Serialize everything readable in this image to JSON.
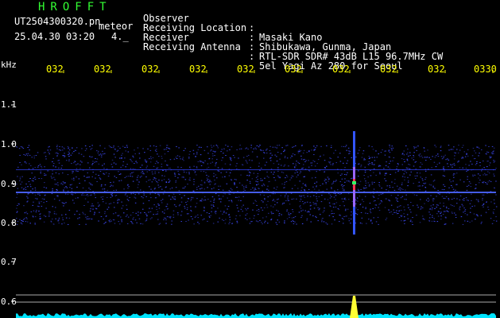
{
  "header": {
    "app_title": "HROFFT",
    "filename": "UT2504300320.pn",
    "mode": "meteor",
    "datetime": "25.04.30 03:20",
    "status": "4._",
    "fields": [
      {
        "label": "Observer",
        "sep": ":",
        "value": "Masaki Kano"
      },
      {
        "label": "Receiving Location",
        "sep": ":",
        "value": "Shibukawa, Gunma, Japan"
      },
      {
        "label": "Receiver",
        "sep": ":",
        "value": "RTL-SDR SDR# 43dB L15 96.7MHz CW"
      },
      {
        "label": "Receiving Antenna",
        "sep": ":",
        "value": "5el Yagi Az 280 for Seoul"
      }
    ]
  },
  "axis": {
    "y_unit": "kHz",
    "y_ticks": [
      "1.1",
      "1.0",
      "0.9",
      "0.8",
      "0.7",
      "0.6"
    ],
    "x_ticks": [
      "032",
      "032",
      "032",
      "032",
      "032",
      "032",
      "032",
      "032",
      "032",
      "0330"
    ]
  },
  "colors": {
    "background": "#000000",
    "header_label": "#ffffff",
    "tick_text": "#ffff00",
    "title": "#33ff33",
    "noise": "#1a1aff",
    "baseline": "#00e5ff"
  }
}
